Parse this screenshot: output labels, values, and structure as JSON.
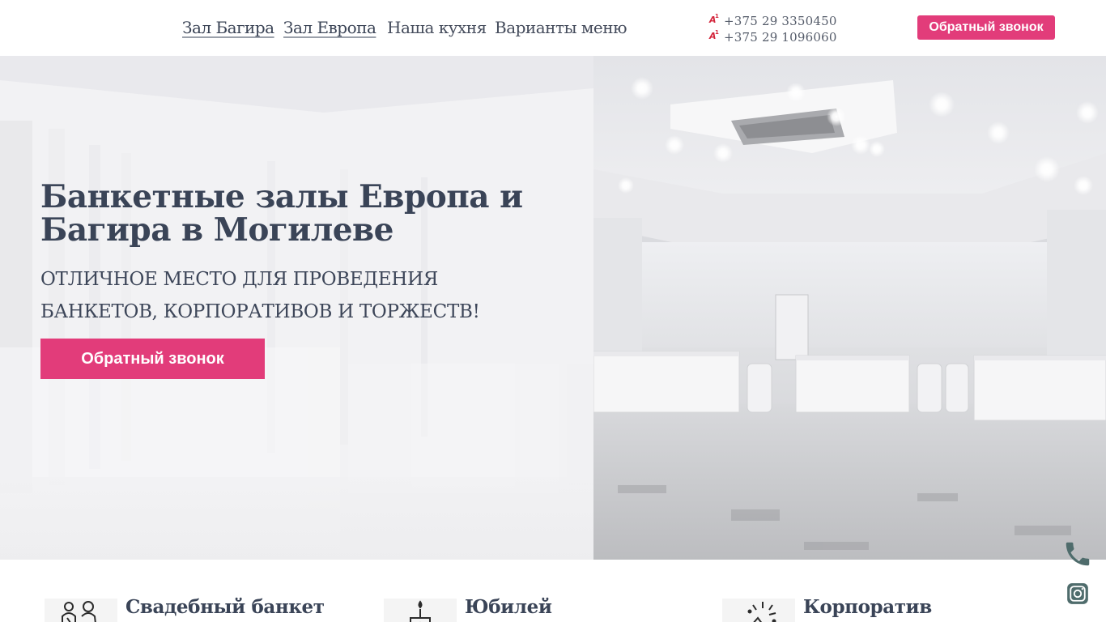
{
  "nav": {
    "items": [
      {
        "label": "Зал Багира"
      },
      {
        "label": "Зал Европа"
      },
      {
        "label": "Наша кухня"
      },
      {
        "label": "Варианты меню"
      }
    ]
  },
  "contacts": {
    "phones": [
      "+375 29 3350450",
      "+375 29 1096060"
    ],
    "operator_logo_text": "A1",
    "operator_color": "#d3253b"
  },
  "header": {
    "callback_label": "Обратный звонок"
  },
  "hero": {
    "title": "Банкетные залы Европа и Багира в Могилеве",
    "subtitle": "ОТЛИЧНОЕ МЕСТО ДЛЯ ПРОВЕДЕНИЯ БАНКЕТОВ, КОРПОРАТИВОВ И ТОРЖЕСТВ!",
    "callback_label": "Обратный звонок"
  },
  "cards": [
    {
      "title": "Свадебный банкет",
      "icon": "wedding-couple-icon"
    },
    {
      "title": "Юбилей",
      "icon": "birthday-cake-icon"
    },
    {
      "title": "Корпоратив",
      "icon": "celebration-icon"
    }
  ],
  "floating": {
    "phone_icon": "phone-icon",
    "instagram_icon": "instagram-icon"
  },
  "colors": {
    "accent": "#e23c7a",
    "text": "#3a4457",
    "float_icon": "#4f6c6c"
  }
}
